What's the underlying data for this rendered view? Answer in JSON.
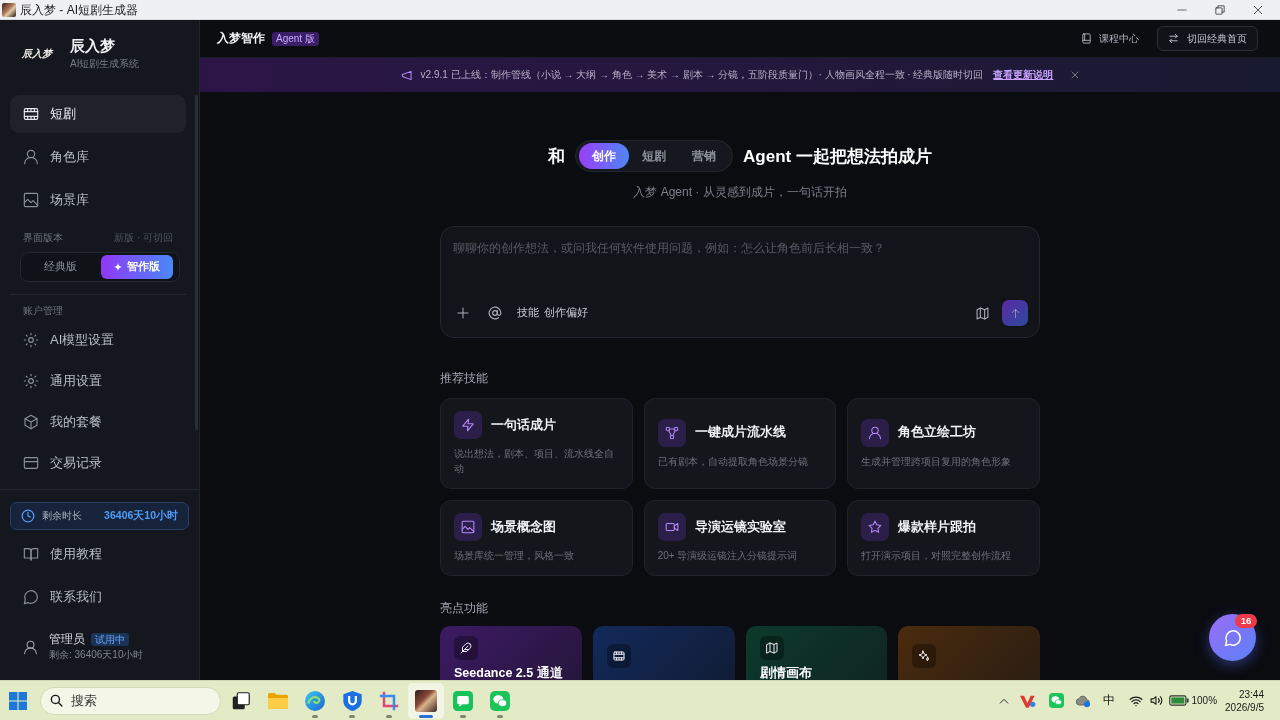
{
  "window": {
    "title": "辰入梦 - AI短剧生成器"
  },
  "sidebar": {
    "logo": "辰入梦",
    "brand": "辰入梦",
    "tagline": "AI短剧生成系统",
    "nav": [
      {
        "label": "短剧",
        "selected": true
      },
      {
        "label": "角色库",
        "selected": false
      },
      {
        "label": "场景库",
        "selected": false
      }
    ],
    "version": {
      "label": "界面版本",
      "hint": "新版 · 可切回",
      "options": [
        {
          "label": "经典版",
          "selected": false
        },
        {
          "label": "智作版",
          "selected": true
        }
      ]
    },
    "account": {
      "label": "账户管理",
      "items": [
        {
          "label": "AI模型设置",
          "selected": false
        },
        {
          "label": "通用设置",
          "selected": false
        },
        {
          "label": "我的套餐",
          "selected": false
        },
        {
          "label": "交易记录",
          "selected": false
        }
      ]
    },
    "remaining": {
      "label": "剩余时长",
      "value": "36406天10小时"
    },
    "help": [
      {
        "label": "使用教程",
        "selected": false
      },
      {
        "label": "联系我们",
        "selected": false
      }
    ],
    "user": {
      "name": "管理员",
      "badge": "试用中",
      "remaining": "剩余: 36406天10小时"
    }
  },
  "topbar": {
    "title": "入梦智作",
    "badge": "Agent 版",
    "link": "课程中心",
    "button": "切回经典首页"
  },
  "banner": {
    "text": "v2.9.1 已上线：制作管线（小说 → 大纲 → 角色 → 美术 → 剧本 → 分镜，五阶段质量门）· 人物画风全程一致 · 经典版随时切回",
    "link": "查看更新说明"
  },
  "hero": {
    "prefix": "和",
    "modes": [
      {
        "label": "创作",
        "selected": true
      },
      {
        "label": "短剧",
        "selected": false
      },
      {
        "label": "营销",
        "selected": false
      }
    ],
    "suffix": "Agent 一起把想法拍成片",
    "subtitle": "入梦 Agent · 从灵感到成片，一句话开拍"
  },
  "composer": {
    "placeholder": "聊聊你的创作想法，或问我任何软件使用问题，例如：怎么让角色前后长相一致？",
    "chips": [
      "技能",
      "创作偏好"
    ]
  },
  "skills": {
    "title": "推荐技能",
    "items": [
      {
        "title": "一句话成片",
        "desc": "说出想法，剧本、项目、流水线全自动"
      },
      {
        "title": "一键成片流水线",
        "desc": "已有剧本，自动提取角色场景分镜"
      },
      {
        "title": "角色立绘工坊",
        "desc": "生成并管理跨项目复用的角色形象"
      },
      {
        "title": "场景概念图",
        "desc": "场景库统一管理，风格一致"
      },
      {
        "title": "导演运镜实验室",
        "desc": "20+ 导演级运镜注入分镜提示词"
      },
      {
        "title": "爆款样片跟拍",
        "desc": "打开演示项目，对照完整创作流程"
      }
    ]
  },
  "highlights": {
    "title": "亮点功能",
    "items": [
      {
        "title": "Seedance 2.5 通道",
        "color": "#3d1a64"
      },
      {
        "color": "#12295a"
      },
      {
        "title": "剧情画布",
        "color": "#0c3a2b"
      },
      {
        "color": "#4b2b0c"
      }
    ]
  },
  "chat_button": {
    "badge": "16"
  },
  "taskbar": {
    "search": {
      "placeholder": "搜索"
    },
    "apps": [
      {
        "open": false,
        "selected": false
      },
      {
        "open": true,
        "selected": false
      },
      {
        "open": true,
        "selected": false
      },
      {
        "open": true,
        "selected": false
      },
      {
        "open": true,
        "selected": true
      },
      {
        "open": true,
        "selected": false
      },
      {
        "open": true,
        "selected": false
      }
    ],
    "tray": {
      "ime": "中",
      "battery": "100%",
      "time": "23:44",
      "date": "2026/9/5"
    }
  }
}
